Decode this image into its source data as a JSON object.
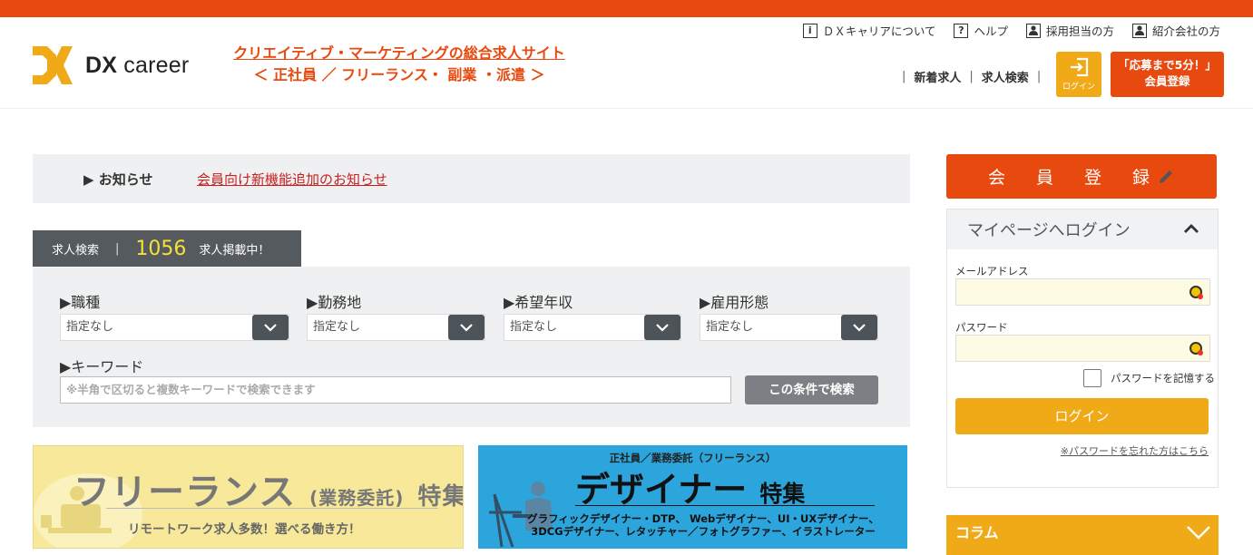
{
  "colors": {
    "brand": "#e8490e",
    "accent": "#f0a917",
    "count": "#f6e03b"
  },
  "header": {
    "logo_text_dx": "DX",
    "logo_text_career": "career",
    "tagline_line1": "クリエイティブ・マーケティングの総合求人サイト",
    "tagline_line2": "＜ 正社員 ／ フリーランス・ 副業 ・派遣 ＞",
    "util_nav": [
      {
        "label": "ＤＸキャリアについて",
        "icon": "info-icon"
      },
      {
        "label": "ヘルプ",
        "icon": "help-icon"
      },
      {
        "label": "採用担当の方",
        "icon": "person-icon"
      },
      {
        "label": "紹介会社の方",
        "icon": "person-icon"
      }
    ],
    "main_nav": [
      "新着求人",
      "求人検索"
    ],
    "login_label": "ログイン",
    "register_line1": "「応募まで5分！」",
    "register_line2": "会員登録"
  },
  "notice": {
    "label": "▶ お知らせ",
    "link": "会員向け新機能追加のお知らせ"
  },
  "search": {
    "tab_label": "求人検索",
    "tab_separator": "|",
    "count": "1056",
    "count_suffix": "求人掲載中！",
    "fields": [
      {
        "label": "▶職種",
        "value": "指定なし"
      },
      {
        "label": "▶勤務地",
        "value": "指定なし"
      },
      {
        "label": "▶希望年収",
        "value": "指定なし"
      },
      {
        "label": "▶雇用形態",
        "value": "指定なし"
      }
    ],
    "keyword_label": "▶キーワード",
    "keyword_placeholder": "※半角で区切ると複数キーワードで検索できます",
    "submit_label": "この条件で検索"
  },
  "banners": {
    "freelance": {
      "title_main": "フリーランス",
      "title_paren": "(業務委託)",
      "title_suffix": "特集",
      "subtitle": "リモートワーク求人多数！選べる働き方！"
    },
    "designer": {
      "top": "正社員／業務委託（フリーランス）",
      "title_main": "デザイナー",
      "title_suffix": "特集",
      "sub_line1": "グラフィックデザイナー・DTP、 Webデザイナー、UI・UXデザイナー、",
      "sub_line2": "3DCGデザイナー、レタッチャー／フォトグラファー、イラストレーター"
    }
  },
  "sidebar": {
    "register_label": "会 員 登 録",
    "login_title": "マイページへログイン",
    "email_label": "メールアドレス",
    "password_label": "パスワード",
    "remember_label": "パスワードを記憶する",
    "login_button": "ログイン",
    "forgot_link": "※パスワードを忘れた方はこちら",
    "column_label": "コラム"
  }
}
